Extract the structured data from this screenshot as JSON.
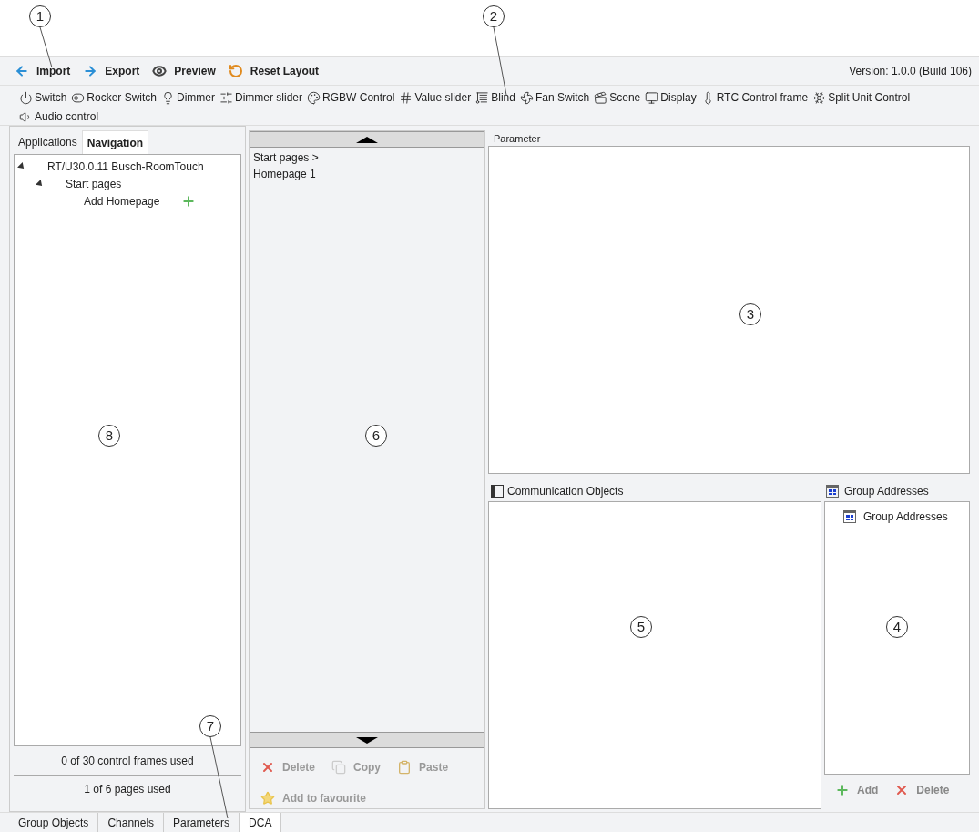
{
  "callouts": [
    {
      "label": "1"
    },
    {
      "label": "2"
    },
    {
      "label": "3"
    },
    {
      "label": "4"
    },
    {
      "label": "5"
    },
    {
      "label": "6"
    },
    {
      "label": "7"
    },
    {
      "label": "8"
    }
  ],
  "toolbar": {
    "actions": [
      {
        "label": "Import"
      },
      {
        "label": "Export"
      },
      {
        "label": "Preview"
      },
      {
        "label": "Reset Layout"
      }
    ],
    "version": "Version: 1.0.0 (Build 106)"
  },
  "controls": [
    {
      "label": "Switch"
    },
    {
      "label": "Rocker Switch"
    },
    {
      "label": "Dimmer"
    },
    {
      "label": "Dimmer slider"
    },
    {
      "label": "RGBW Control"
    },
    {
      "label": "Value slider"
    },
    {
      "label": "Blind"
    },
    {
      "label": "Fan Switch"
    },
    {
      "label": "Scene"
    },
    {
      "label": "Display"
    },
    {
      "label": "RTC Control frame"
    },
    {
      "label": "Split Unit Control"
    },
    {
      "label": "Audio control"
    }
  ],
  "left_panel": {
    "tabs": [
      {
        "label": "Applications",
        "selected": false
      },
      {
        "label": "Navigation",
        "selected": true
      }
    ],
    "tree": [
      {
        "label": "RT/U30.0.11 Busch-RoomTouch",
        "expanded": true,
        "children": [
          {
            "label": "Start pages",
            "expanded": true,
            "children": [
              {
                "label": "Add Homepage",
                "kind": "add"
              }
            ]
          }
        ]
      }
    ],
    "footer": [
      "0 of 30 control frames used",
      "1 of 6 pages used"
    ]
  },
  "middle_panel": {
    "breadcrumb": "Start pages >",
    "page": "Homepage 1",
    "actions": [
      {
        "label": "Delete",
        "kind": "delete"
      },
      {
        "label": "Copy",
        "kind": "copy"
      },
      {
        "label": "Paste",
        "kind": "paste"
      },
      {
        "label": "Add to favourite",
        "kind": "favourite"
      }
    ]
  },
  "parameter_panel": {
    "title": "Parameter"
  },
  "communication_objects": {
    "title": "Communication Objects"
  },
  "group_addresses": {
    "title": "Group Addresses",
    "items": [
      "Group Addresses"
    ],
    "actions": [
      {
        "label": "Add",
        "kind": "add"
      },
      {
        "label": "Delete",
        "kind": "delete"
      }
    ]
  },
  "bottom_tabs": [
    {
      "label": "Group Objects",
      "selected": false
    },
    {
      "label": "Channels",
      "selected": false
    },
    {
      "label": "Parameters",
      "selected": false
    },
    {
      "label": "DCA",
      "selected": true
    }
  ]
}
